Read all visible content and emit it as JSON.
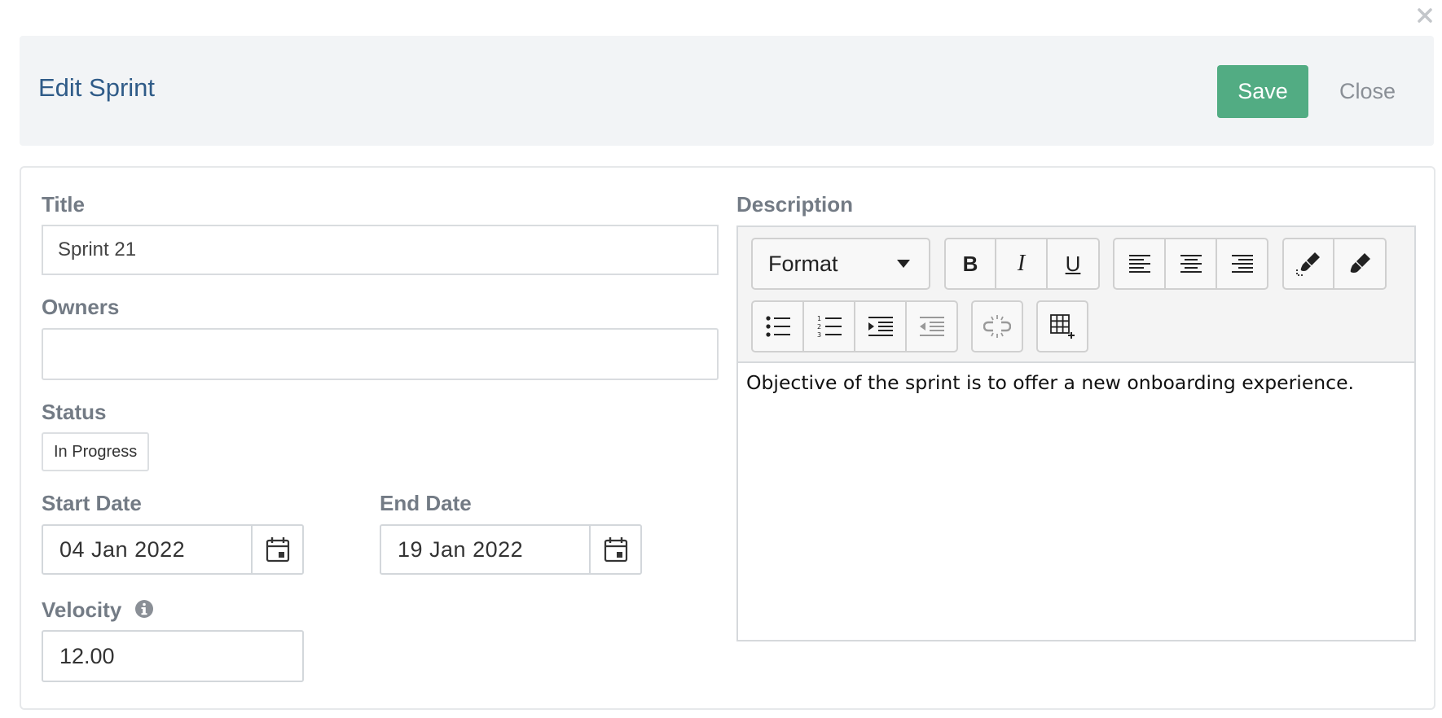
{
  "dialog": {
    "title": "Edit Sprint",
    "save_label": "Save",
    "close_label": "Close"
  },
  "form": {
    "title_label": "Title",
    "title_value": "Sprint 21",
    "owners_label": "Owners",
    "owners_value": "",
    "status_label": "Status",
    "status_value": "In Progress",
    "start_date_label": "Start Date",
    "start_date_value": "04 Jan 2022",
    "end_date_label": "End Date",
    "end_date_value": "19 Jan 2022",
    "velocity_label": "Velocity",
    "velocity_value": "12.00",
    "description_label": "Description",
    "description_text": "Objective of the sprint is to offer a new onboarding experience."
  },
  "editor_toolbar": {
    "format_label": "Format",
    "bold": "B",
    "italic": "I",
    "underline": "U"
  },
  "colors": {
    "save_button": "#52ac83",
    "header_bg": "#f2f4f6",
    "title_text": "#2f5b88",
    "label_text": "#737b85"
  }
}
